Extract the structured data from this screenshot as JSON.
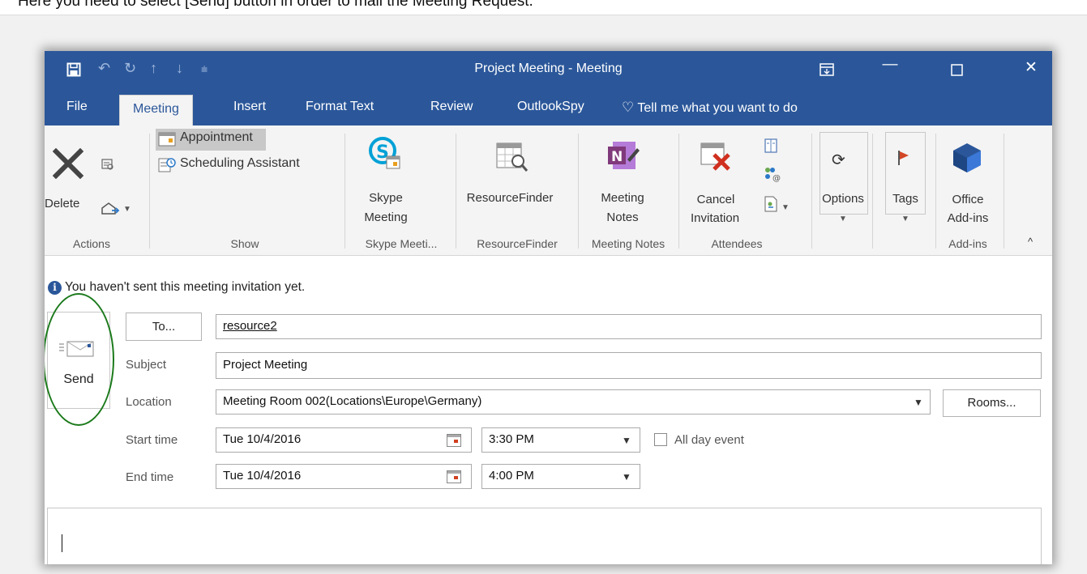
{
  "caption": "Here you need to select [Send] button in order to mail the Meeting Request.",
  "window": {
    "title": "Project Meeting - Meeting",
    "qat_icons": [
      "save-icon",
      "undo-icon",
      "redo-icon",
      "up-arrow-icon",
      "down-arrow-icon",
      "customize-icon"
    ],
    "controls": [
      "ribbon-display-icon",
      "minimize-icon",
      "maximize-icon",
      "close-icon"
    ]
  },
  "tabs": [
    "File",
    "Meeting",
    "Insert",
    "Format Text",
    "Review",
    "OutlookSpy"
  ],
  "tell_me": "Tell me what you want to do",
  "ribbon": {
    "actions": {
      "delete": "Delete",
      "group": "Actions"
    },
    "show": {
      "appointment": "Appointment",
      "scheduling": "Scheduling Assistant",
      "group": "Show"
    },
    "skype": {
      "label1": "Skype",
      "label2": "Meeting",
      "group": "Skype Meeti..."
    },
    "resourcefinder": {
      "label": "ResourceFinder",
      "group": "ResourceFinder"
    },
    "meetingnotes": {
      "label1": "Meeting",
      "label2": "Notes",
      "group": "Meeting Notes"
    },
    "attendees": {
      "cancel1": "Cancel",
      "cancel2": "Invitation",
      "group": "Attendees"
    },
    "options": {
      "label": "Options"
    },
    "tags": {
      "label": "Tags"
    },
    "addins": {
      "label1": "Office",
      "label2": "Add-ins",
      "group": "Add-ins"
    }
  },
  "info_bar": "You haven't sent this meeting invitation yet.",
  "form": {
    "send_label": "Send",
    "to_button": "To...",
    "to_value": "resource2",
    "subject_label": "Subject",
    "subject_value": "Project Meeting",
    "location_label": "Location",
    "location_value": "Meeting Room 002(Locations\\Europe\\Germany)",
    "rooms_button": "Rooms...",
    "start_label": "Start time",
    "start_date": "Tue 10/4/2016",
    "start_time": "3:30 PM",
    "allday_label": "All day event",
    "end_label": "End time",
    "end_date": "Tue 10/4/2016",
    "end_time": "4:00 PM"
  },
  "colors": {
    "accent": "#2b579a",
    "highlight_ellipse": "#1b7a1b"
  }
}
